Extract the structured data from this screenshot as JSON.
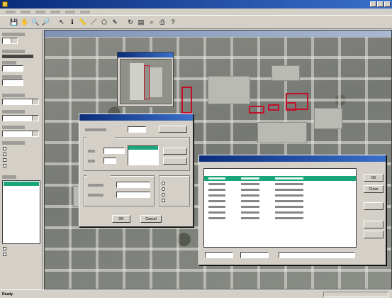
{
  "titlebar": {
    "title": ""
  },
  "menu": {
    "items": [
      "",
      "",
      "",
      "",
      "",
      ""
    ]
  },
  "toolbar": {
    "buttons": [
      {
        "icon": "save-icon",
        "glyph": "💾"
      },
      {
        "icon": "pan-icon",
        "glyph": "✋"
      },
      {
        "icon": "zoom-in-icon",
        "glyph": "🔍"
      },
      {
        "icon": "zoom-out-icon",
        "glyph": "🔎"
      },
      {
        "icon": "select-icon",
        "glyph": "↖"
      },
      {
        "icon": "identify-icon",
        "glyph": "ℹ"
      },
      {
        "icon": "measure-icon",
        "glyph": "📏"
      },
      {
        "icon": "draw-line-icon",
        "glyph": "／"
      },
      {
        "icon": "draw-polygon-icon",
        "glyph": "⬠"
      },
      {
        "icon": "edit-icon",
        "glyph": "✎"
      },
      {
        "icon": "refresh-icon",
        "glyph": "↻"
      },
      {
        "icon": "layers-icon",
        "glyph": "▤"
      },
      {
        "icon": "query-icon",
        "glyph": "⌕"
      },
      {
        "icon": "print-icon",
        "glyph": "⎙"
      },
      {
        "icon": "help-icon",
        "glyph": "?"
      }
    ]
  },
  "map_window": {
    "title": ""
  },
  "dialog_search": {
    "title": "",
    "ok_label": "OK",
    "cancel_label": "Cancel"
  },
  "dialog_results": {
    "title": "",
    "buttons": [
      "OK",
      "Close",
      "",
      "",
      ""
    ],
    "rows": 9,
    "highlighted_row": 1
  },
  "statusbar": {
    "text": "Ready"
  },
  "colors": {
    "parcel_outline": "#c2102a",
    "selection": "#1aa57a",
    "title_active": "#0a2c7a"
  }
}
